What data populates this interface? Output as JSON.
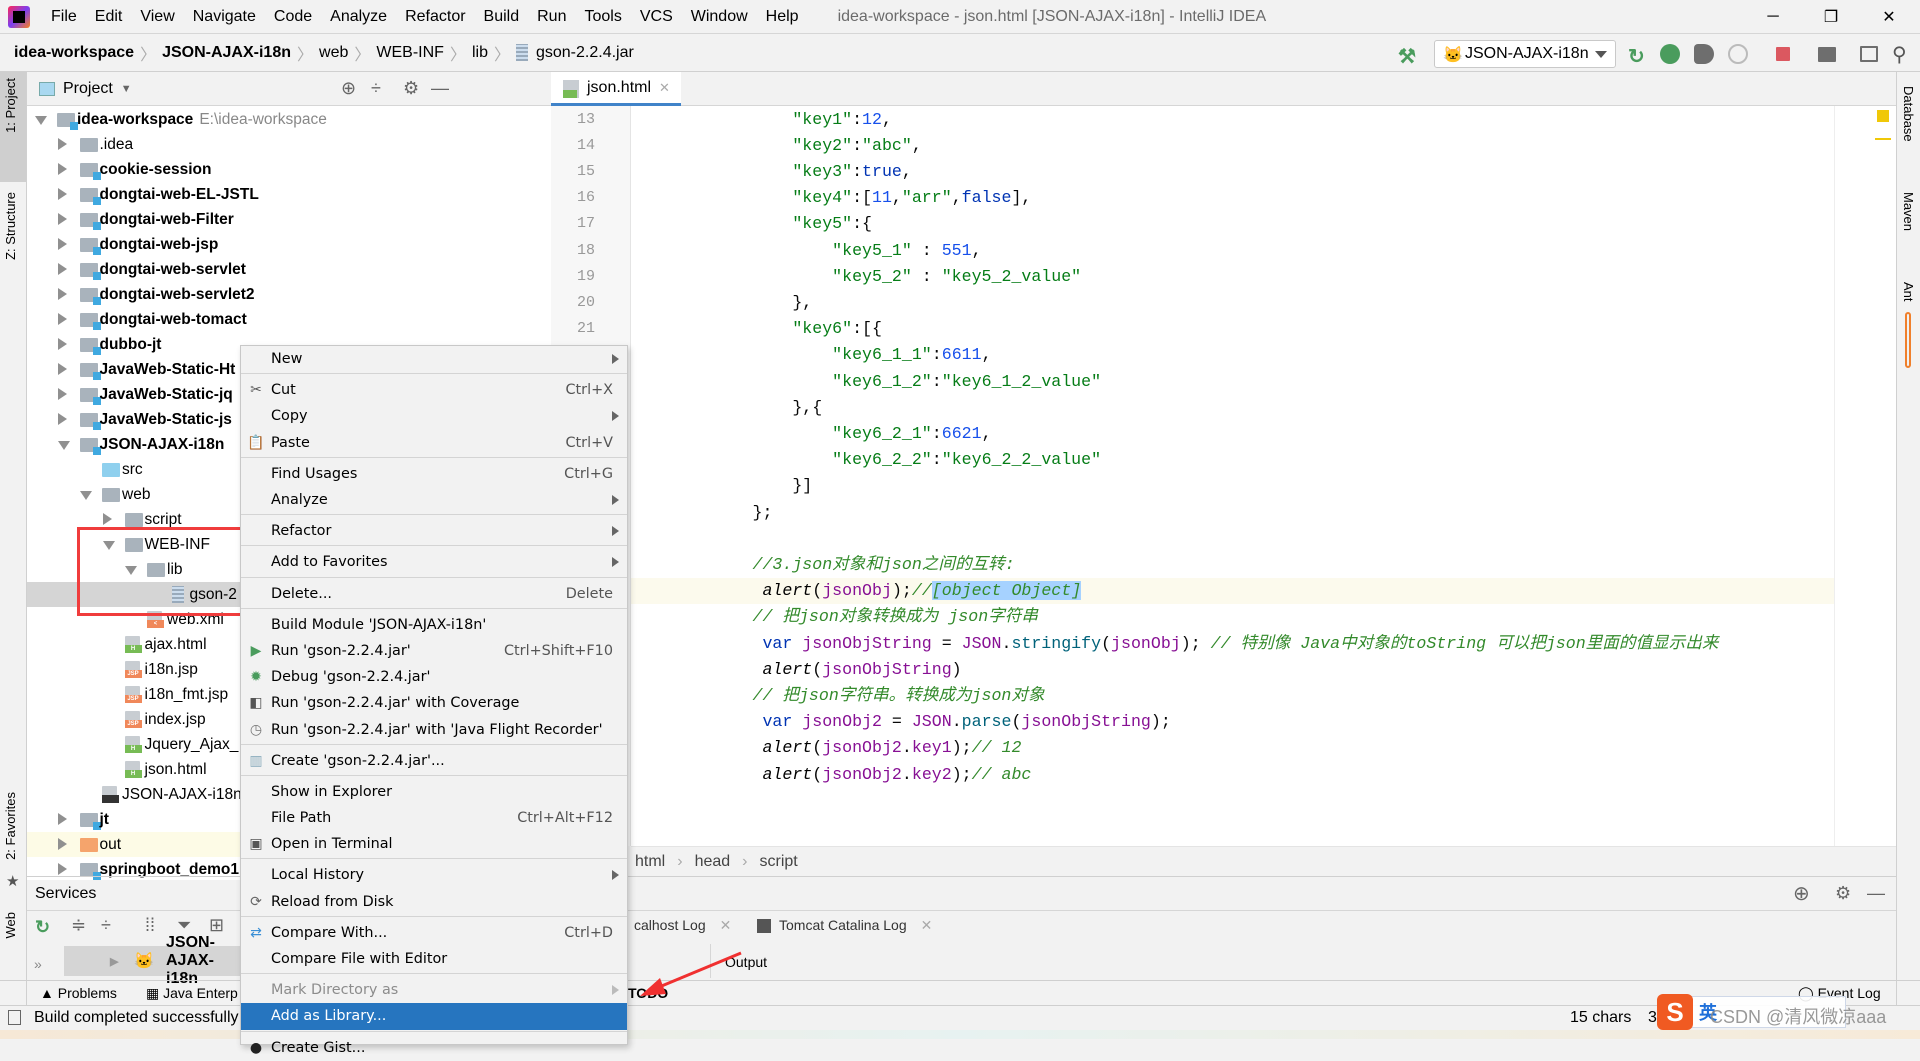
{
  "menubar": {
    "items": [
      "File",
      "Edit",
      "View",
      "Navigate",
      "Code",
      "Analyze",
      "Refactor",
      "Build",
      "Run",
      "Tools",
      "VCS",
      "Window",
      "Help"
    ],
    "title": "idea-workspace - json.html [JSON-AJAX-i18n] - IntelliJ IDEA"
  },
  "breadcrumb": [
    "idea-workspace",
    "JSON-AJAX-i18n",
    "web",
    "WEB-INF",
    "lib",
    "gson-2.2.4.jar"
  ],
  "toolbar": {
    "run_config": "JSON-AJAX-i18n",
    "stop_color": "#db5860"
  },
  "left_strip": {
    "project": "1: Project",
    "structure": "Z: Structure",
    "favorites": "2: Favorites",
    "web": "Web"
  },
  "right_strip": {
    "database": "Database",
    "maven": "Maven",
    "ant": "Ant"
  },
  "project_panel": {
    "title": "Project",
    "tree": [
      {
        "name": "idea-workspace",
        "hint": "E:\\idea-workspace",
        "level": 0,
        "state": "open",
        "icon": "module",
        "bold": true
      },
      {
        "name": ".idea",
        "level": 1,
        "state": "closed",
        "icon": "folder"
      },
      {
        "name": "cookie-session",
        "level": 1,
        "state": "closed",
        "icon": "module",
        "bold": true
      },
      {
        "name": "dongtai-web-EL-JSTL",
        "level": 1,
        "state": "closed",
        "icon": "module",
        "bold": true
      },
      {
        "name": "dongtai-web-Filter",
        "level": 1,
        "state": "closed",
        "icon": "module",
        "bold": true
      },
      {
        "name": "dongtai-web-jsp",
        "level": 1,
        "state": "closed",
        "icon": "module",
        "bold": true
      },
      {
        "name": "dongtai-web-servlet",
        "level": 1,
        "state": "closed",
        "icon": "module",
        "bold": true
      },
      {
        "name": "dongtai-web-servlet2",
        "level": 1,
        "state": "closed",
        "icon": "module",
        "bold": true
      },
      {
        "name": "dongtai-web-tomact",
        "level": 1,
        "state": "closed",
        "icon": "module",
        "bold": true
      },
      {
        "name": "dubbo-jt",
        "level": 1,
        "state": "closed",
        "icon": "module",
        "bold": true
      },
      {
        "name": "JavaWeb-Static-Ht",
        "level": 1,
        "state": "closed",
        "icon": "module",
        "bold": true
      },
      {
        "name": "JavaWeb-Static-jq",
        "level": 1,
        "state": "closed",
        "icon": "module",
        "bold": true
      },
      {
        "name": "JavaWeb-Static-js",
        "level": 1,
        "state": "closed",
        "icon": "module",
        "bold": true
      },
      {
        "name": "JSON-AJAX-i18n",
        "level": 1,
        "state": "open",
        "icon": "module",
        "bold": true
      },
      {
        "name": "src",
        "level": 2,
        "state": "none",
        "icon": "src"
      },
      {
        "name": "web",
        "level": 2,
        "state": "open",
        "icon": "folder"
      },
      {
        "name": "script",
        "level": 3,
        "state": "closed",
        "icon": "folder"
      },
      {
        "name": "WEB-INF",
        "level": 3,
        "state": "open",
        "icon": "folder"
      },
      {
        "name": "lib",
        "level": 4,
        "state": "open",
        "icon": "folder"
      },
      {
        "name": "gson-2",
        "level": 5,
        "state": "none",
        "icon": "jar",
        "selected": true
      },
      {
        "name": "web.xml",
        "level": 4,
        "state": "none",
        "icon": "xml"
      },
      {
        "name": "ajax.html",
        "level": 3,
        "state": "none",
        "icon": "html"
      },
      {
        "name": "i18n.jsp",
        "level": 3,
        "state": "none",
        "icon": "jsp"
      },
      {
        "name": "i18n_fmt.jsp",
        "level": 3,
        "state": "none",
        "icon": "jsp"
      },
      {
        "name": "index.jsp",
        "level": 3,
        "state": "none",
        "icon": "jsp"
      },
      {
        "name": "Jquery_Ajax_",
        "level": 3,
        "state": "none",
        "icon": "html"
      },
      {
        "name": "json.html",
        "level": 3,
        "state": "none",
        "icon": "html"
      },
      {
        "name": "JSON-AJAX-i18n",
        "level": 2,
        "state": "none",
        "icon": "iml"
      },
      {
        "name": "jt",
        "level": 1,
        "state": "closed",
        "icon": "module",
        "bold": true
      },
      {
        "name": "out",
        "level": 1,
        "state": "closed",
        "icon": "out",
        "highlight": true
      },
      {
        "name": "springboot_demo1",
        "level": 1,
        "state": "closed",
        "icon": "module",
        "bold": true
      }
    ]
  },
  "editor": {
    "tab": "json.html",
    "lines": [
      {
        "n": "13",
        "t": [
          [
            "p",
            "                "
          ],
          [
            "s",
            "\"key1\""
          ],
          [
            "p",
            ":"
          ],
          [
            "n",
            "12"
          ],
          [
            "p",
            ","
          ]
        ]
      },
      {
        "n": "14",
        "t": [
          [
            "p",
            "                "
          ],
          [
            "s",
            "\"key2\""
          ],
          [
            "p",
            ":"
          ],
          [
            "s",
            "\"abc\""
          ],
          [
            "p",
            ","
          ]
        ]
      },
      {
        "n": "15",
        "t": [
          [
            "p",
            "                "
          ],
          [
            "s",
            "\"key3\""
          ],
          [
            "p",
            ":"
          ],
          [
            "k",
            "true"
          ],
          [
            "p",
            ","
          ]
        ]
      },
      {
        "n": "16",
        "t": [
          [
            "p",
            "                "
          ],
          [
            "s",
            "\"key4\""
          ],
          [
            "p",
            ":["
          ],
          [
            "n",
            "11"
          ],
          [
            "p",
            ","
          ],
          [
            "s",
            "\"arr\""
          ],
          [
            "p",
            ","
          ],
          [
            "k",
            "false"
          ],
          [
            "p",
            "],"
          ]
        ]
      },
      {
        "n": "17",
        "t": [
          [
            "p",
            "                "
          ],
          [
            "s",
            "\"key5\""
          ],
          [
            "p",
            ":{"
          ]
        ]
      },
      {
        "n": "18",
        "t": [
          [
            "p",
            "                    "
          ],
          [
            "s",
            "\"key5_1\""
          ],
          [
            "p",
            " : "
          ],
          [
            "n",
            "551"
          ],
          [
            "p",
            ","
          ]
        ]
      },
      {
        "n": "19",
        "t": [
          [
            "p",
            "                    "
          ],
          [
            "s",
            "\"key5_2\""
          ],
          [
            "p",
            " : "
          ],
          [
            "s",
            "\"key5_2_value\""
          ]
        ]
      },
      {
        "n": "20",
        "t": [
          [
            "p",
            "                },"
          ]
        ]
      },
      {
        "n": "21",
        "t": [
          [
            "p",
            "                "
          ],
          [
            "s",
            "\"key6\""
          ],
          [
            "p",
            ":[{"
          ]
        ]
      },
      {
        "t": [
          [
            "p",
            "                    "
          ],
          [
            "s",
            "\"key6_1_1\""
          ],
          [
            "p",
            ":"
          ],
          [
            "n",
            "6611"
          ],
          [
            "p",
            ","
          ]
        ]
      },
      {
        "t": [
          [
            "p",
            "                    "
          ],
          [
            "s",
            "\"key6_1_2\""
          ],
          [
            "p",
            ":"
          ],
          [
            "s",
            "\"key6_1_2_value\""
          ]
        ]
      },
      {
        "t": [
          [
            "p",
            "                },{"
          ]
        ]
      },
      {
        "t": [
          [
            "p",
            "                    "
          ],
          [
            "s",
            "\"key6_2_1\""
          ],
          [
            "p",
            ":"
          ],
          [
            "n",
            "6621"
          ],
          [
            "p",
            ","
          ]
        ]
      },
      {
        "t": [
          [
            "p",
            "                    "
          ],
          [
            "s",
            "\"key6_2_2\""
          ],
          [
            "p",
            ":"
          ],
          [
            "s",
            "\"key6_2_2_value\""
          ]
        ]
      },
      {
        "t": [
          [
            "p",
            "                }]"
          ]
        ]
      },
      {
        "t": [
          [
            "p",
            "            };"
          ]
        ]
      },
      {
        "t": []
      },
      {
        "t": [
          [
            "p",
            "            "
          ],
          [
            "c",
            "//3.json对象和json之间的互转:"
          ]
        ]
      },
      {
        "caret": true,
        "t": [
          [
            "p",
            "             "
          ],
          [
            "f",
            "alert"
          ],
          [
            "p",
            "("
          ],
          [
            "v",
            "jsonObj"
          ],
          [
            "p",
            ");"
          ],
          [
            "c",
            "//"
          ],
          [
            "sel",
            "[object Object]"
          ]
        ]
      },
      {
        "t": [
          [
            "p",
            "            "
          ],
          [
            "c",
            "// 把json对象转换成为 json字符串"
          ]
        ]
      },
      {
        "t": [
          [
            "p",
            "             "
          ],
          [
            "k",
            "var "
          ],
          [
            "v",
            "jsonObjString"
          ],
          [
            "p",
            " = "
          ],
          [
            "v",
            "JSON"
          ],
          [
            "p",
            "."
          ],
          [
            "m",
            "stringify"
          ],
          [
            "p",
            "("
          ],
          [
            "v",
            "jsonObj"
          ],
          [
            "p",
            "); "
          ],
          [
            "c",
            "// 特别像 Java中对象的toString 可以把json里面的值显示出来"
          ]
        ]
      },
      {
        "t": [
          [
            "p",
            "             "
          ],
          [
            "f",
            "alert"
          ],
          [
            "p",
            "("
          ],
          [
            "v",
            "jsonObjString"
          ],
          [
            "p",
            ")"
          ]
        ]
      },
      {
        "t": [
          [
            "p",
            "            "
          ],
          [
            "c",
            "// 把json字符串。转换成为json对象"
          ]
        ]
      },
      {
        "t": [
          [
            "p",
            "             "
          ],
          [
            "k",
            "var "
          ],
          [
            "v",
            "jsonObj2"
          ],
          [
            "p",
            " = "
          ],
          [
            "v",
            "JSON"
          ],
          [
            "p",
            "."
          ],
          [
            "m",
            "parse"
          ],
          [
            "p",
            "("
          ],
          [
            "v",
            "jsonObjString"
          ],
          [
            "p",
            ");"
          ]
        ]
      },
      {
        "t": [
          [
            "p",
            "             "
          ],
          [
            "f",
            "alert"
          ],
          [
            "p",
            "("
          ],
          [
            "v",
            "jsonObj2"
          ],
          [
            "p",
            "."
          ],
          [
            "v",
            "key1"
          ],
          [
            "p",
            ");"
          ],
          [
            "c",
            "// 12"
          ]
        ]
      },
      {
        "t": [
          [
            "p",
            "             "
          ],
          [
            "f",
            "alert"
          ],
          [
            "p",
            "("
          ],
          [
            "v",
            "jsonObj2"
          ],
          [
            "p",
            "."
          ],
          [
            "v",
            "key2"
          ],
          [
            "p",
            ");"
          ],
          [
            "c",
            "// abc"
          ]
        ]
      }
    ],
    "breadcrumb": [
      "html",
      "head",
      "script"
    ]
  },
  "context_menu": [
    {
      "label": "New",
      "sub": true
    },
    {
      "sep": true
    },
    {
      "label": "Cut",
      "shortcut": "Ctrl+X",
      "icon": "scissors"
    },
    {
      "label": "Copy",
      "sub": true
    },
    {
      "label": "Paste",
      "shortcut": "Ctrl+V",
      "icon": "clipboard"
    },
    {
      "sep": true
    },
    {
      "label": "Find Usages",
      "shortcut": "Ctrl+G"
    },
    {
      "label": "Analyze",
      "sub": true
    },
    {
      "sep": true
    },
    {
      "label": "Refactor",
      "sub": true
    },
    {
      "sep": true
    },
    {
      "label": "Add to Favorites",
      "sub": true
    },
    {
      "sep": true
    },
    {
      "label": "Delete...",
      "shortcut": "Delete"
    },
    {
      "sep": true
    },
    {
      "label": "Build Module 'JSON-AJAX-i18n'"
    },
    {
      "label": "Run 'gson-2.2.4.jar'",
      "shortcut": "Ctrl+Shift+F10",
      "icon": "run"
    },
    {
      "label": "Debug 'gson-2.2.4.jar'",
      "icon": "debug"
    },
    {
      "label": "Run 'gson-2.2.4.jar' with Coverage",
      "icon": "coverage"
    },
    {
      "label": "Run 'gson-2.2.4.jar' with 'Java Flight Recorder'",
      "icon": "profiler"
    },
    {
      "sep": true
    },
    {
      "label": "Create 'gson-2.2.4.jar'...",
      "icon": "jar"
    },
    {
      "sep": true
    },
    {
      "label": "Show in Explorer"
    },
    {
      "label": "File Path",
      "shortcut": "Ctrl+Alt+F12"
    },
    {
      "label": "Open in Terminal",
      "icon": "terminal"
    },
    {
      "sep": true
    },
    {
      "label": "Local History",
      "sub": true
    },
    {
      "label": "Reload from Disk",
      "icon": "reload"
    },
    {
      "sep": true
    },
    {
      "label": "Compare With...",
      "shortcut": "Ctrl+D",
      "icon": "compare"
    },
    {
      "label": "Compare File with Editor"
    },
    {
      "sep": true
    },
    {
      "label": "Mark Directory as",
      "sub": true,
      "disabled": true
    },
    {
      "label": "Add as Library...",
      "active": true
    },
    {
      "sep": true
    },
    {
      "label": "Create Gist...",
      "icon": "github"
    }
  ],
  "services": {
    "title": "Services",
    "row": "JSON-AJAX-i18n",
    "tabs": [
      "calhost Log",
      "Tomcat Catalina Log"
    ],
    "output": "Output"
  },
  "bottom_tabs": {
    "problems": "Problems",
    "java_enterprise": "Java Enterp",
    "todo": "TODO",
    "event_log": "Event Log"
  },
  "status": {
    "message": "Build completed successfully",
    "chars": "15 chars",
    "position": "31"
  },
  "ime": {
    "lang": "英"
  },
  "watermark": "CSDN @清风微凉aaa"
}
